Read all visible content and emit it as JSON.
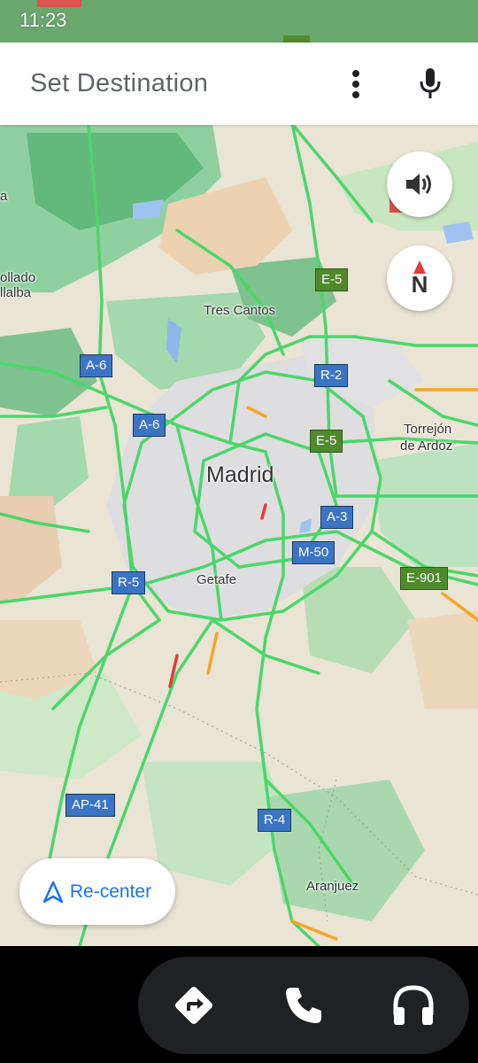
{
  "status_bar": {
    "time": "11:23"
  },
  "search_bar": {
    "placeholder": "Set Destination"
  },
  "map": {
    "places": {
      "madrid": "Madrid",
      "tres_cantos": "Tres Cantos",
      "getafe": "Getafe",
      "torrejon_line1": "Torrejón",
      "torrejon_line2": "de Ardoz",
      "aranjuez": "Aranjuez",
      "collado_line1": "ollado",
      "collado_line2": "llalba",
      "edge_a": "a"
    },
    "road_shields": {
      "a6_north": "A-6",
      "a6_mid": "A-6",
      "e5_north": "E-5",
      "r2": "R-2",
      "e5_city": "E-5",
      "a3": "A-3",
      "m50": "M-50",
      "r5": "R-5",
      "e901": "E-901",
      "ap41": "AP-41",
      "r4": "R-4"
    },
    "compass_label": "N"
  },
  "controls": {
    "recenter_label": "Re-center"
  },
  "dock": {
    "items": [
      "navigation-icon",
      "phone-icon",
      "headphones-icon"
    ]
  },
  "colors": {
    "accent": "#1a73e8",
    "traffic_free": "#4cd66a",
    "traffic_slow": "#f5a623",
    "traffic_heavy": "#e53935"
  }
}
